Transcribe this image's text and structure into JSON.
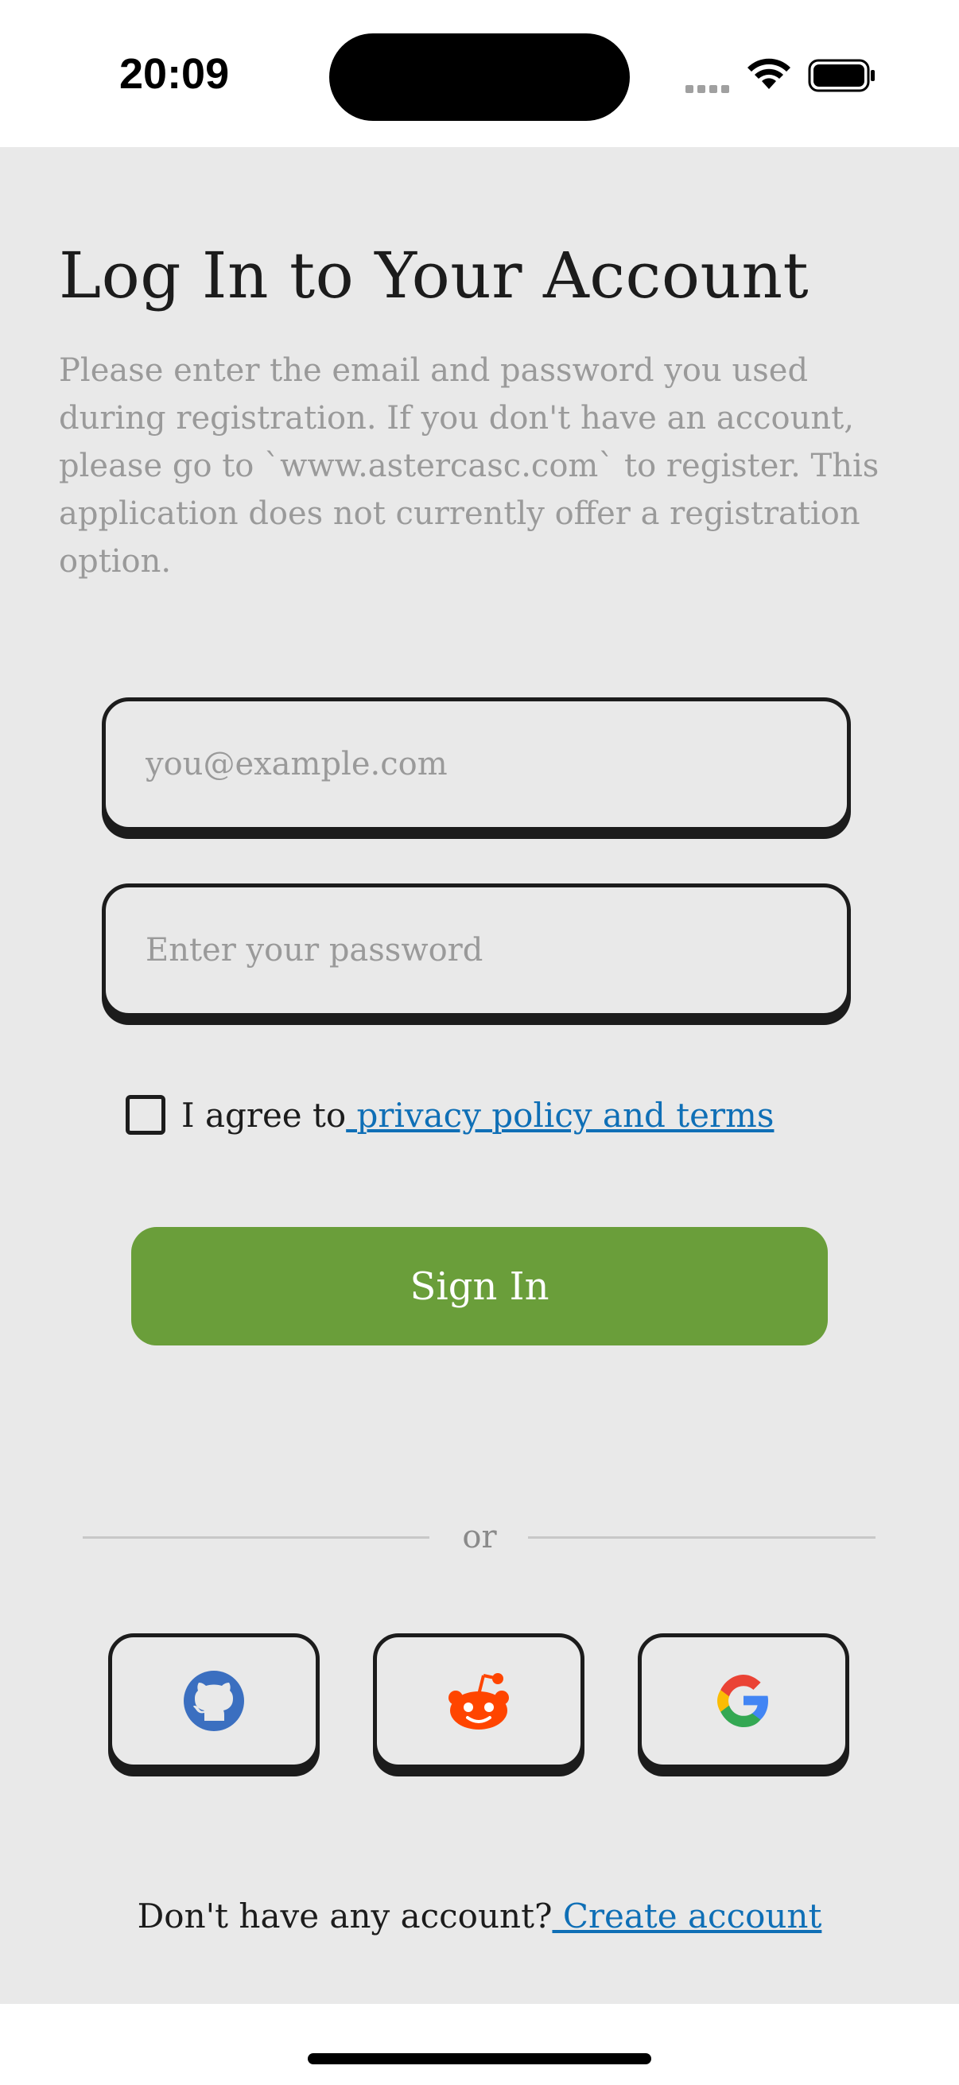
{
  "status_bar": {
    "time": "20:09"
  },
  "login": {
    "title": "Log In to Your Account",
    "description": "Please enter the email and password you used during registration. If you don't have an account, please go to `www.astercasc.com` to register. This application does not currently offer a registration option.",
    "email_placeholder": "you@example.com",
    "email_value": "",
    "password_placeholder": "Enter your password",
    "password_value": "",
    "agree_prefix": "I agree to",
    "agree_link": " privacy policy and terms",
    "agree_checked": false,
    "sign_in_label": "Sign In",
    "divider_text": "or",
    "social_buttons": [
      {
        "icon": "github-icon",
        "color": "#3b6fc0"
      },
      {
        "icon": "reddit-icon",
        "color": "#ff4500"
      },
      {
        "icon": "google-icon",
        "colors": [
          "#4285f4",
          "#ea4335",
          "#fbbc05",
          "#34a853"
        ]
      }
    ],
    "footer_prefix": "Don't have any account?",
    "footer_link": " Create account"
  },
  "colors": {
    "background": "#e9e9e9",
    "accent_green": "#6a9e3a",
    "link_blue": "#0f6fb6",
    "muted_text": "#9a9a9a",
    "border": "#1c1c1c"
  }
}
